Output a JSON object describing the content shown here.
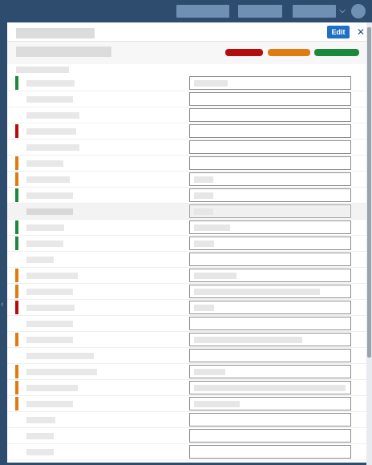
{
  "topbar": {
    "nav_items": [
      {
        "name": "nav-item-1"
      },
      {
        "name": "nav-item-2"
      },
      {
        "name": "nav-item-3"
      }
    ],
    "dropdown_icon": "chevron-down-icon",
    "avatar_icon": "user-avatar"
  },
  "panel": {
    "edit_label": "Edit",
    "close_glyph": "✕",
    "legend_colors": [
      "#b50d0d",
      "#e07b12",
      "#1a8a3a"
    ]
  },
  "colors": {
    "red": "#b50d0d",
    "orange": "#e07b12",
    "green": "#1a8a3a",
    "edit_button": "#1f6fc7",
    "header": "#2d4c6e"
  },
  "rows": [
    {
      "status": "green"
    },
    {
      "status": "none"
    },
    {
      "status": "none"
    },
    {
      "status": "red"
    },
    {
      "status": "none"
    },
    {
      "status": "orange"
    },
    {
      "status": "orange"
    },
    {
      "status": "green"
    },
    {
      "status": "group"
    },
    {
      "status": "green"
    },
    {
      "status": "green"
    },
    {
      "status": "none"
    },
    {
      "status": "orange"
    },
    {
      "status": "orange"
    },
    {
      "status": "red"
    },
    {
      "status": "none"
    },
    {
      "status": "orange"
    },
    {
      "status": "none"
    },
    {
      "status": "orange"
    },
    {
      "status": "orange"
    },
    {
      "status": "orange"
    },
    {
      "status": "none"
    },
    {
      "status": "none"
    },
    {
      "status": "none"
    }
  ]
}
